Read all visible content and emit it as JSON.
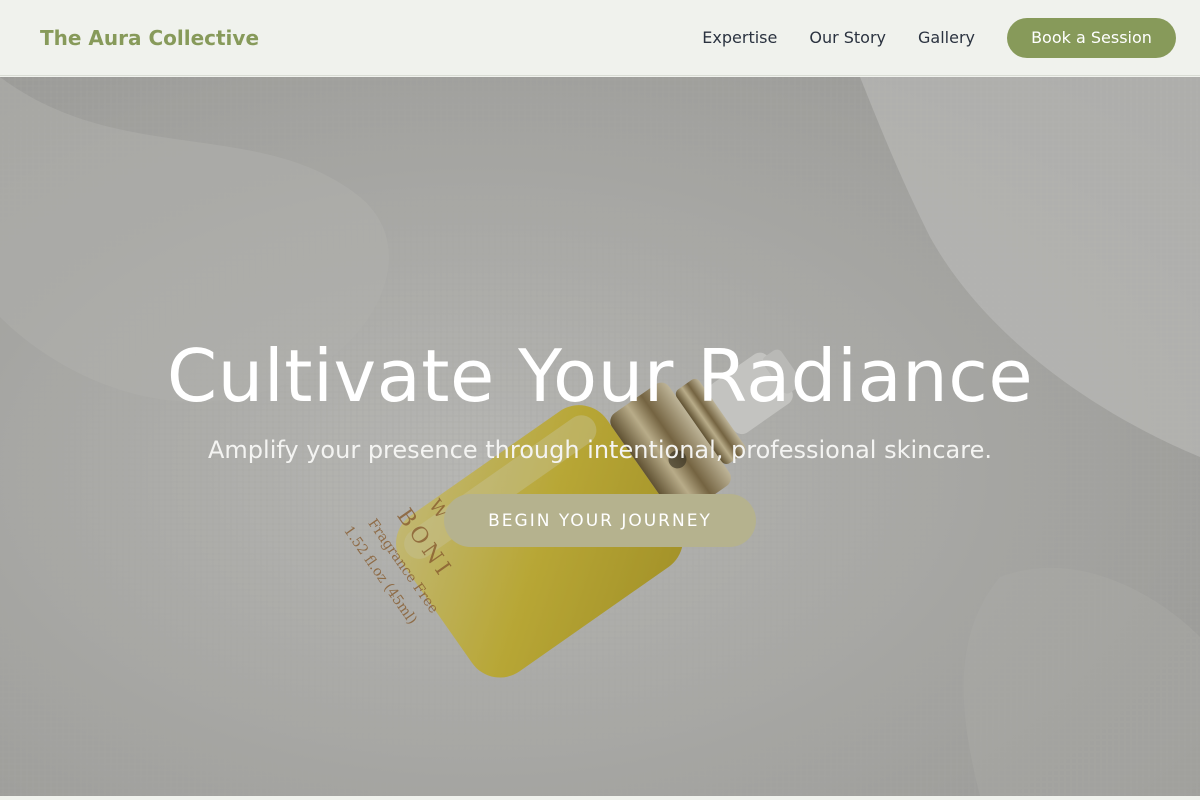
{
  "nav": {
    "brand": "The Aura Collective",
    "links": [
      "Expertise",
      "Our Story",
      "Gallery"
    ],
    "cta_label": "Book a Session"
  },
  "hero": {
    "title": "Cultivate Your Radiance",
    "subtitle": "Amplify your presence through intentional, professional skincare.",
    "button_label": "BEGIN YOUR JOURNEY",
    "image_subject": "serum-bottle-photo",
    "bottle_label": {
      "line1": "WATER OIL",
      "brand": "BONI ROS",
      "line3": "Fragrance Free",
      "volume": "1.52 fl.oz (45ml)"
    }
  },
  "colors": {
    "brand": "#879a5a",
    "nav_background": "#f0f2ed",
    "nav_text": "#2b3340",
    "hero_button": "#b5b28e",
    "hero_text": "#ffffff"
  }
}
